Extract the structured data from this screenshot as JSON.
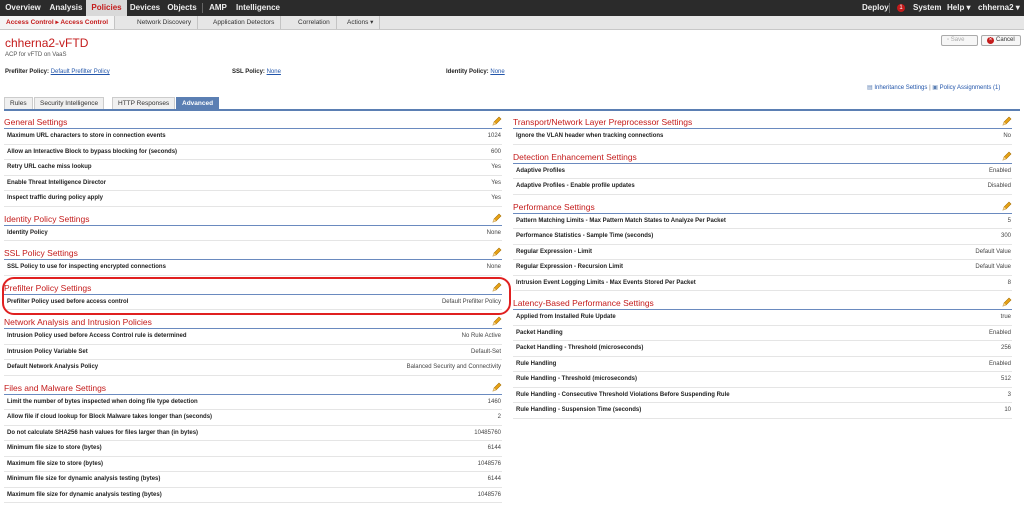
{
  "topnav": {
    "items": [
      "Overview",
      "Analysis",
      "Policies",
      "Devices",
      "Objects",
      "AMP",
      "Intelligence"
    ],
    "active": "Policies",
    "deploy": "Deploy",
    "alert_count": "1",
    "system": "System",
    "help": "Help ▾",
    "user": "chherna2 ▾"
  },
  "subnav": {
    "items": [
      "Access Control ▸ Access Control",
      "Network Discovery",
      "Application Detectors",
      "Correlation",
      "Actions ▾"
    ]
  },
  "policy": {
    "title": "chherna2-vFTD",
    "description": "ACP for vFTD on VaaS",
    "save": "Save",
    "cancel": "Cancel"
  },
  "policies": {
    "prefilter_label": "Prefilter Policy:",
    "prefilter_value": "Default Prefilter Policy",
    "ssl_label": "SSL Policy:",
    "ssl_value": "None",
    "identity_label": "Identity Policy:",
    "identity_value": "None"
  },
  "links": {
    "inheritance": "Inheritance Settings",
    "separator": "|",
    "assignments": "Policy Assignments (1)"
  },
  "tabs": [
    "Rules",
    "Security Intelligence",
    "HTTP Responses",
    "Advanced"
  ],
  "active_tab": "Advanced",
  "left_sections": [
    {
      "title": "General Settings",
      "rows": [
        [
          "Maximum URL characters to store in connection events",
          "1024"
        ],
        [
          "Allow an Interactive Block to bypass blocking for (seconds)",
          "600"
        ],
        [
          "Retry URL cache miss lookup",
          "Yes"
        ],
        [
          "Enable Threat Intelligence Director",
          "Yes"
        ],
        [
          "Inspect traffic during policy apply",
          "Yes"
        ]
      ]
    },
    {
      "title": "Identity Policy Settings",
      "rows": [
        [
          "Identity Policy",
          "None"
        ]
      ]
    },
    {
      "title": "SSL Policy Settings",
      "rows": [
        [
          "SSL Policy to use for inspecting encrypted connections",
          "None"
        ]
      ]
    },
    {
      "title": "Prefilter Policy Settings",
      "rows": [
        [
          "Prefilter Policy used before access control",
          "Default Prefilter Policy"
        ]
      ]
    },
    {
      "title": "Network Analysis and Intrusion Policies",
      "rows": [
        [
          "Intrusion Policy used before Access Control rule is determined",
          "No Rule Active"
        ],
        [
          "Intrusion Policy Variable Set",
          "Default-Set"
        ],
        [
          "Default Network Analysis Policy",
          "Balanced Security and Connectivity"
        ]
      ]
    },
    {
      "title": "Files and Malware Settings",
      "rows": [
        [
          "Limit the number of bytes inspected when doing file type detection",
          "1460"
        ],
        [
          "Allow file if cloud lookup for Block Malware takes longer than (seconds)",
          "2"
        ],
        [
          "Do not calculate SHA256 hash values for files larger than (in bytes)",
          "10485760"
        ],
        [
          "Minimum file size to store (bytes)",
          "6144"
        ],
        [
          "Maximum file size to store (bytes)",
          "1048576"
        ],
        [
          "Minimum file size for dynamic analysis testing (bytes)",
          "6144"
        ],
        [
          "Maximum file size for dynamic analysis testing (bytes)",
          "1048576"
        ]
      ]
    }
  ],
  "right_sections": [
    {
      "title": "Transport/Network Layer Preprocessor Settings",
      "rows": [
        [
          "Ignore the VLAN header when tracking connections",
          "No"
        ]
      ]
    },
    {
      "title": "Detection Enhancement Settings",
      "rows": [
        [
          "Adaptive Profiles",
          "Enabled"
        ],
        [
          "Adaptive Profiles - Enable profile updates",
          "Disabled"
        ]
      ]
    },
    {
      "title": "Performance Settings",
      "rows": [
        [
          "Pattern Matching Limits - Max Pattern Match States to Analyze Per Packet",
          "5"
        ],
        [
          "Performance Statistics - Sample Time (seconds)",
          "300"
        ],
        [
          "Regular Expression - Limit",
          "Default Value"
        ],
        [
          "Regular Expression - Recursion Limit",
          "Default Value"
        ],
        [
          "Intrusion Event Logging Limits - Max Events Stored Per Packet",
          "8"
        ]
      ]
    },
    {
      "title": "Latency-Based Performance Settings",
      "rows": [
        [
          "Applied from Installed Rule Update",
          "true"
        ],
        [
          "Packet Handling",
          "Enabled"
        ],
        [
          "Packet Handling - Threshold (microseconds)",
          "256"
        ],
        [
          "Rule Handling",
          "Enabled"
        ],
        [
          "Rule Handling - Threshold (microseconds)",
          "512"
        ],
        [
          "Rule Handling - Consecutive Threshold Violations Before Suspending Rule",
          "3"
        ],
        [
          "Rule Handling - Suspension Time (seconds)",
          "10"
        ]
      ]
    }
  ],
  "colors": {
    "accent": "#c41b1b",
    "tab_active": "#5b7fb3",
    "highlight": "#e02020",
    "pencil": "#e8a317"
  }
}
